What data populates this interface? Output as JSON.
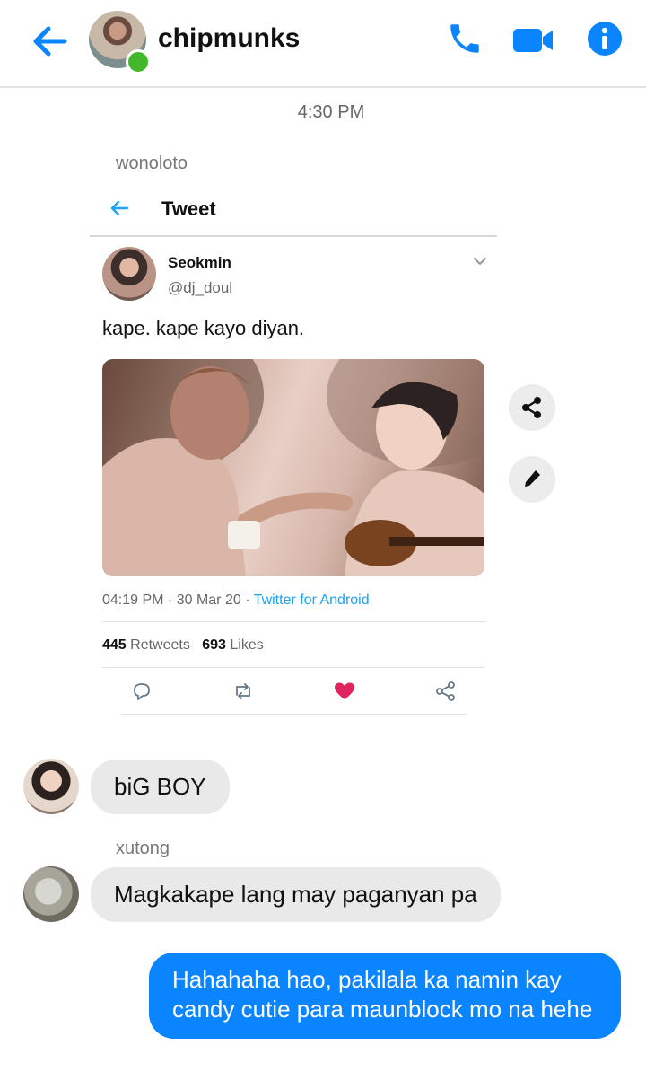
{
  "header": {
    "title": "chipmunks",
    "accent_color": "#0a84ff",
    "online_color": "#42b72a"
  },
  "thread": {
    "timestamp": "4:30 PM",
    "messages": [
      {
        "sender": "wonoloto",
        "type": "tweet-screenshot",
        "tweet": {
          "topbar_title": "Tweet",
          "author_name": "Seokmin",
          "author_handle": "@dj_doul",
          "text": "kape. kape kayo diyan.",
          "time": "04:19 PM · 30 Mar 20 · ",
          "source": "Twitter for Android",
          "retweets": "445",
          "retweets_label": "Retweets",
          "likes": "693",
          "likes_label": "Likes",
          "liked": true
        }
      },
      {
        "sender": "",
        "type": "text",
        "text": "biG BOY"
      },
      {
        "sender": "xutong",
        "type": "text",
        "text": "Magkakape lang may paganyan pa"
      },
      {
        "sender": "me",
        "type": "text",
        "text": "Hahahaha hao, pakilala ka namin kay candy cutie para maunblock mo na hehe"
      }
    ]
  },
  "icons": {
    "back": "arrow-left-icon",
    "call": "phone-icon",
    "video": "video-camera-icon",
    "info": "info-icon",
    "share": "share-icon",
    "edit": "pencil-icon"
  }
}
